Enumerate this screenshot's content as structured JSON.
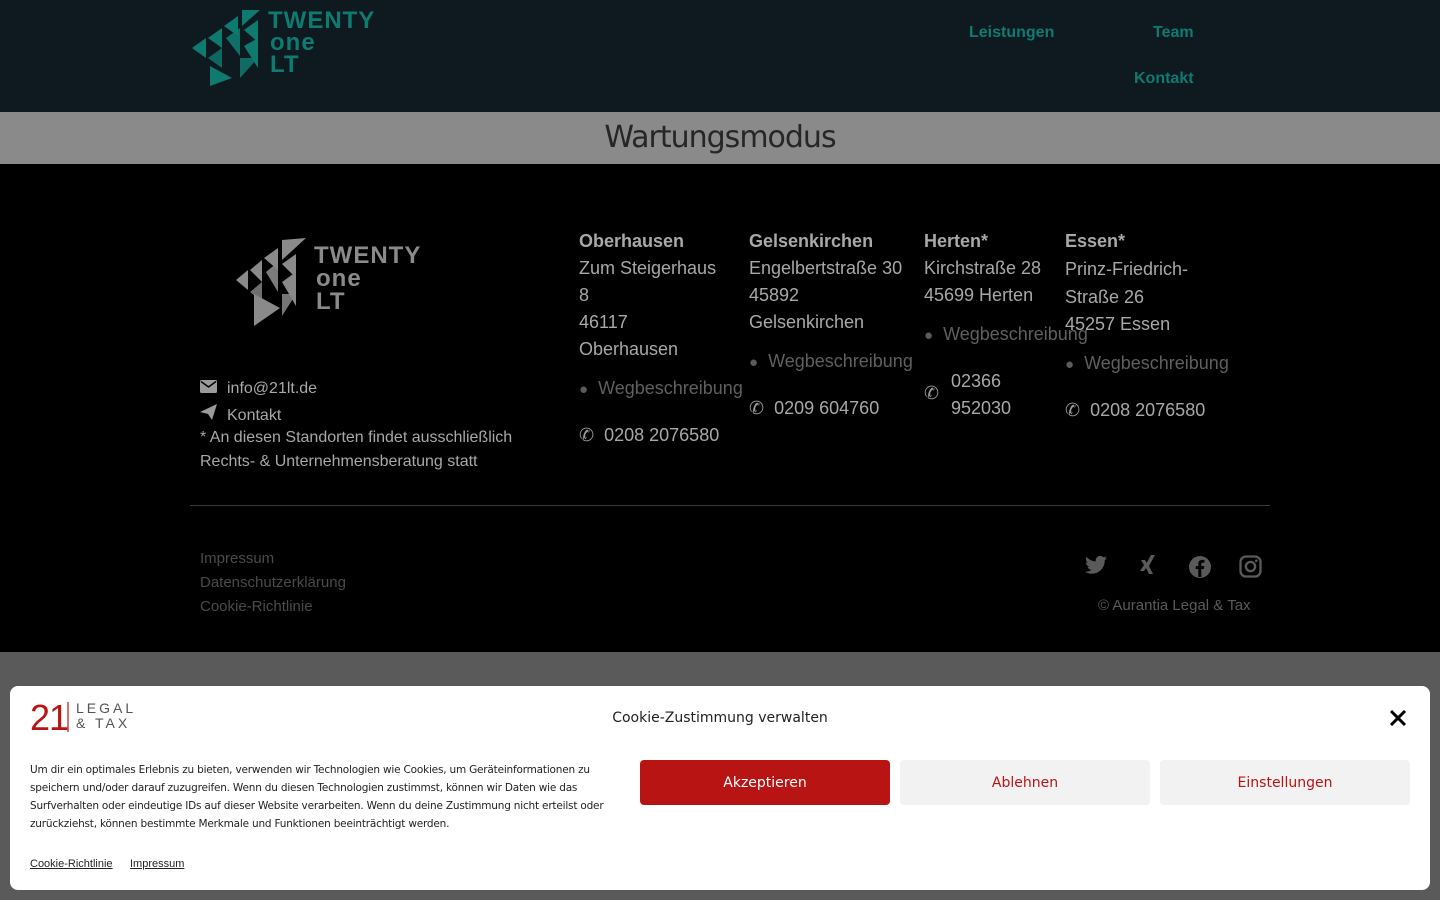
{
  "header": {
    "logo_text": [
      "TWENTY",
      "one",
      "LT"
    ],
    "nav": [
      "Leistungen",
      "Team",
      "Kontakt"
    ]
  },
  "maintenance": {
    "title": "Wartungsmodus"
  },
  "footer": {
    "logo_text": [
      "TWENTY",
      "one",
      "LT"
    ],
    "email": "info@21lt.de",
    "contact_label": "Kontakt",
    "note": "* An diesen Standorten findet ausschließlich Rechts- & Unternehmensberatung statt",
    "locations": [
      {
        "city": "Oberhausen",
        "address": [
          "Zum Steigerhaus",
          "8",
          "46117",
          "Oberhausen"
        ],
        "directions": "Wegbeschreibung",
        "phone": "0208 2076580"
      },
      {
        "city": "Gelsenkirchen",
        "address": [
          "Engelbertstraße 30",
          "45892",
          "Gelsenkirchen"
        ],
        "directions": "Wegbeschreibung",
        "phone": "0209 604760"
      },
      {
        "city": "Herten*",
        "address": [
          "Kirchstraße 28",
          "45699 Herten"
        ],
        "directions": "Wegbeschreibung",
        "phone": "02366 952030"
      },
      {
        "city": "Essen*",
        "address": [
          "Prinz-Friedrich-",
          "Straße 26",
          "45257 Essen"
        ],
        "directions": "Wegbeschreibung",
        "phone": "0208 2076580"
      }
    ],
    "links": [
      "Impressum",
      "Datenschutzerklärung",
      "Cookie-Richtlinie"
    ],
    "social_icons": [
      "twitter-icon",
      "xing-icon",
      "facebook-icon",
      "instagram-icon"
    ],
    "copyright": "© Aurantia Legal & Tax"
  },
  "cookie_banner": {
    "logo_number": "21",
    "logo_text": [
      "LEGAL",
      "& TAX"
    ],
    "title": "Cookie-Zustimmung verwalten",
    "text": "Um dir ein optimales Erlebnis zu bieten, verwenden wir Technologien wie Cookies, um Geräteinformationen zu speichern und/oder darauf zuzugreifen. Wenn du diesen Technologien zustimmst, können wir Daten wie das Surfverhalten oder eindeutige IDs auf dieser Website verarbeiten. Wenn du deine Zustimmung nicht erteilst oder zurückziehst, können bestimmte Merkmale und Funktionen beeinträchtigt werden.",
    "accept_label": "Akzeptieren",
    "deny_label": "Ablehnen",
    "settings_label": "Einstellungen",
    "links": [
      "Cookie-Richtlinie",
      "Impressum"
    ]
  },
  "colors": {
    "accent": "#b81414",
    "teal": "#0f7a70",
    "header_bg": "#0e1a1f"
  }
}
